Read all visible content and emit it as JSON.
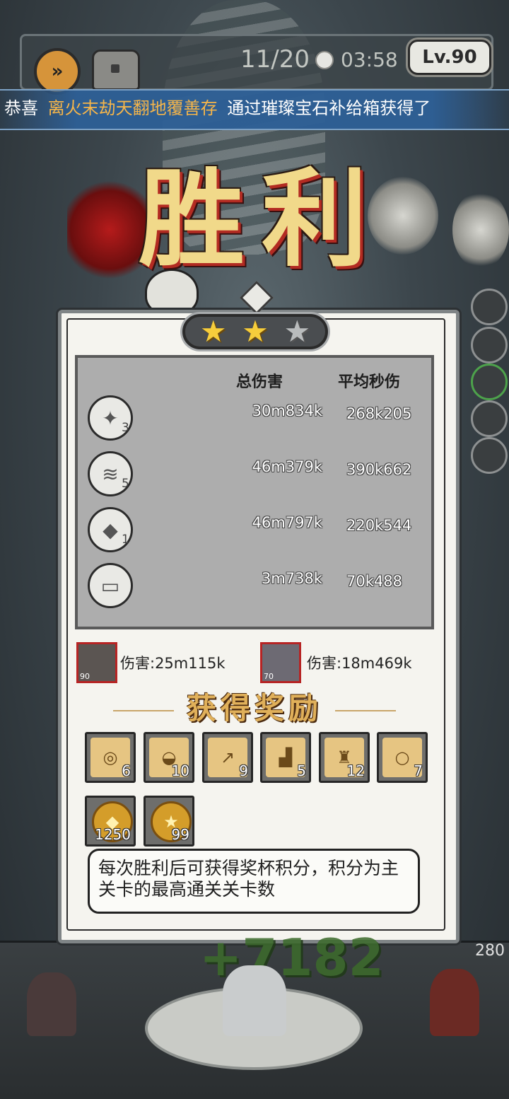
{
  "hud": {
    "wave": "11/20",
    "timer": "03:58",
    "level": "Lv.90",
    "speed_icon": "fast-forward-icon",
    "chest_icon": "treasure-chest-icon"
  },
  "banner": {
    "prefix": "恭喜",
    "player_name": "离火末劫天翻地覆善存",
    "message": "通过璀璨宝石补给箱获得了"
  },
  "victory": {
    "title": "胜利",
    "stars_earned": 2,
    "stars_total": 3
  },
  "stats": {
    "col_total": "总伤害",
    "col_dps": "平均秒伤",
    "skills": [
      {
        "icon": "crystal-burst-icon",
        "level": "3",
        "total": "30m834k",
        "dps": "268k205"
      },
      {
        "icon": "tornado-icon",
        "level": "5",
        "total": "46m379k",
        "dps": "390k662"
      },
      {
        "icon": "ice-shard-icon",
        "level": "1",
        "total": "46m797k",
        "dps": "220k544"
      },
      {
        "icon": "frost-spikes-icon",
        "level": "",
        "total": "3m738k",
        "dps": "70k488"
      }
    ]
  },
  "heroes": [
    {
      "level": "90",
      "damage": "伤害:25m115k"
    },
    {
      "level": "70",
      "damage": "伤害:18m469k"
    }
  ],
  "rewards": {
    "title": "获得奖励",
    "scrolls": [
      {
        "icon": "necklace-scroll-icon",
        "count": "6"
      },
      {
        "icon": "helmet-scroll-icon",
        "count": "10"
      },
      {
        "icon": "weapon-scroll-icon",
        "count": "9"
      },
      {
        "icon": "boots-scroll-icon",
        "count": "5"
      },
      {
        "icon": "armor-scroll-icon",
        "count": "12"
      },
      {
        "icon": "ring-scroll-icon",
        "count": "7"
      }
    ],
    "currency": [
      {
        "icon": "gold-gem-icon",
        "count": "1250"
      },
      {
        "icon": "gold-coin-icon",
        "count": "99"
      }
    ]
  },
  "tip": "每次胜利后可获得奖杯积分，积分为主关卡的最高通关关卡数",
  "battle": {
    "gain": "+7182",
    "side_value": "280"
  }
}
